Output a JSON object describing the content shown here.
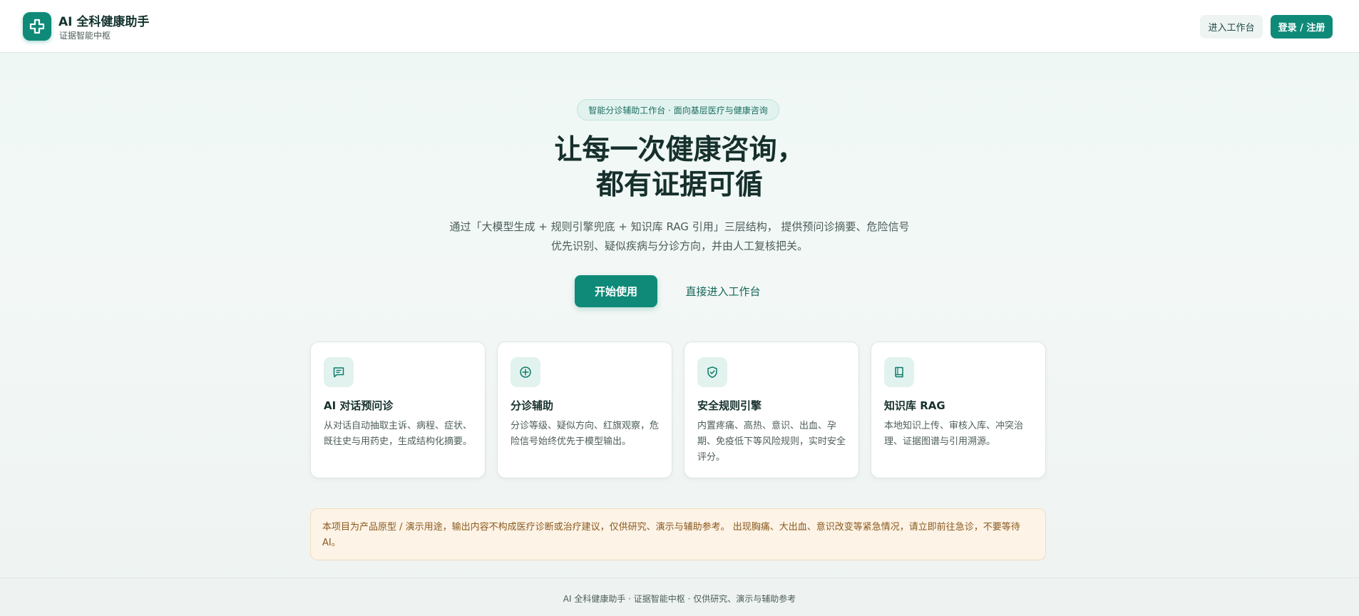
{
  "header": {
    "brand_title": "AI 全科健康助手",
    "brand_subtitle": "证据智能中枢",
    "logo_icon": "medical-cross-icon",
    "workbench_button": "进入工作台",
    "login_button": "登录 / 注册"
  },
  "hero": {
    "pill": "智能分诊辅助工作台 · 面向基层医疗与健康咨询",
    "title_line1": "让每一次健康咨询，",
    "title_line2": "都有证据可循",
    "desc_line1": "通过「大模型生成 + 规则引擎兜底 + 知识库 RAG 引用」三层结构， 提供预问诊摘要、危险信号",
    "desc_line2": "优先识别、疑似疾病与分诊方向，并由人工复核把关。",
    "start_button": "开始使用",
    "direct_button": "直接进入工作台"
  },
  "cards": [
    {
      "icon": "chat-icon",
      "title": "AI 对话预问诊",
      "desc": "从对话自动抽取主诉、病程、症状、既往史与用药史，生成结构化摘要。"
    },
    {
      "icon": "crosshair-icon",
      "title": "分诊辅助",
      "desc": "分诊等级、疑似方向、红旗观察，危险信号始终优先于模型输出。"
    },
    {
      "icon": "shield-check-icon",
      "title": "安全规则引擎",
      "desc": "内置疼痛、高热、意识、出血、孕期、免疫低下等风险规则，实时安全评分。"
    },
    {
      "icon": "book-icon",
      "title": "知识库 RAG",
      "desc": "本地知识上传、审核入库、冲突治理、证据图谱与引用溯源。"
    }
  ],
  "notice": "本项目为产品原型 / 演示用途，输出内容不构成医疗诊断或治疗建议，仅供研究、演示与辅助参考。 出现胸痛、大出血、意识改变等紧急情况，请立即前往急诊，不要等待 AI。",
  "footer": "AI 全科健康助手 · 证据智能中枢 · 仅供研究、演示与辅助参考",
  "colors": {
    "accent": "#0f8a78",
    "accent_light": "#e2f3ef",
    "notice_bg": "#fdf3e6",
    "notice_text": "#8a5a1e"
  }
}
